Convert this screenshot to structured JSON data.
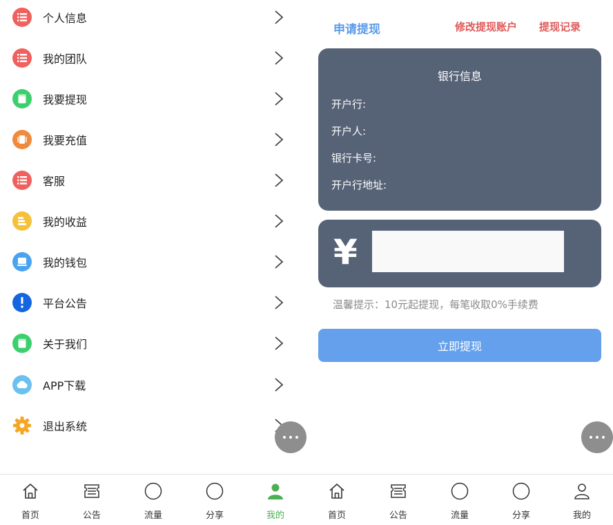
{
  "menu": {
    "items": [
      {
        "label": "个人信息",
        "icon": "list-icon",
        "color": "#f0605e"
      },
      {
        "label": "我的团队",
        "icon": "list-icon",
        "color": "#f0605e"
      },
      {
        "label": "我要提现",
        "icon": "document-icon",
        "color": "#3ccf6d"
      },
      {
        "label": "我要充值",
        "icon": "card-icon",
        "color": "#f08a3c"
      },
      {
        "label": "客服",
        "icon": "list-icon",
        "color": "#f0605e"
      },
      {
        "label": "我的收益",
        "icon": "coins-icon",
        "color": "#f5c13b"
      },
      {
        "label": "我的钱包",
        "icon": "wallet-icon",
        "color": "#4aa3f0"
      },
      {
        "label": "平台公告",
        "icon": "exclamation-icon",
        "color": "#1565e0"
      },
      {
        "label": "关于我们",
        "icon": "document-icon",
        "color": "#3ccf6d"
      },
      {
        "label": "APP下载",
        "icon": "cloud-icon",
        "color": "#6cc0f0"
      },
      {
        "label": "退出系统",
        "icon": "gear-icon",
        "color": "#f5a623"
      }
    ]
  },
  "withdraw": {
    "apply_title": "申请提现",
    "modify_account": "修改提现账户",
    "withdraw_record": "提现记录",
    "bank_info_title": "银行信息",
    "bank_name_label": "开户行:",
    "account_holder_label": "开户人:",
    "card_number_label": "银行卡号:",
    "bank_address_label": "开户行地址:",
    "currency_symbol": "¥",
    "amount_value": "",
    "tip": "温馨提示：10元起提现，每笔收取0%手续费",
    "submit_label": "立即提现"
  },
  "tabbar_left": {
    "tabs": [
      {
        "label": "首页",
        "icon": "home-icon"
      },
      {
        "label": "公告",
        "icon": "notice-icon"
      },
      {
        "label": "流量",
        "icon": "circle-icon"
      },
      {
        "label": "分享",
        "icon": "circle-icon"
      },
      {
        "label": "我的",
        "icon": "user-icon",
        "active": true
      }
    ]
  },
  "tabbar_right": {
    "tabs": [
      {
        "label": "首页",
        "icon": "home-icon"
      },
      {
        "label": "公告",
        "icon": "notice-icon"
      },
      {
        "label": "流量",
        "icon": "circle-icon"
      },
      {
        "label": "分享",
        "icon": "circle-icon"
      },
      {
        "label": "我的",
        "icon": "user-icon"
      }
    ]
  },
  "colors": {
    "card_bg": "#566377",
    "accent_blue": "#5b9be8",
    "accent_red": "#e05a5a",
    "active_green": "#4caf50"
  }
}
